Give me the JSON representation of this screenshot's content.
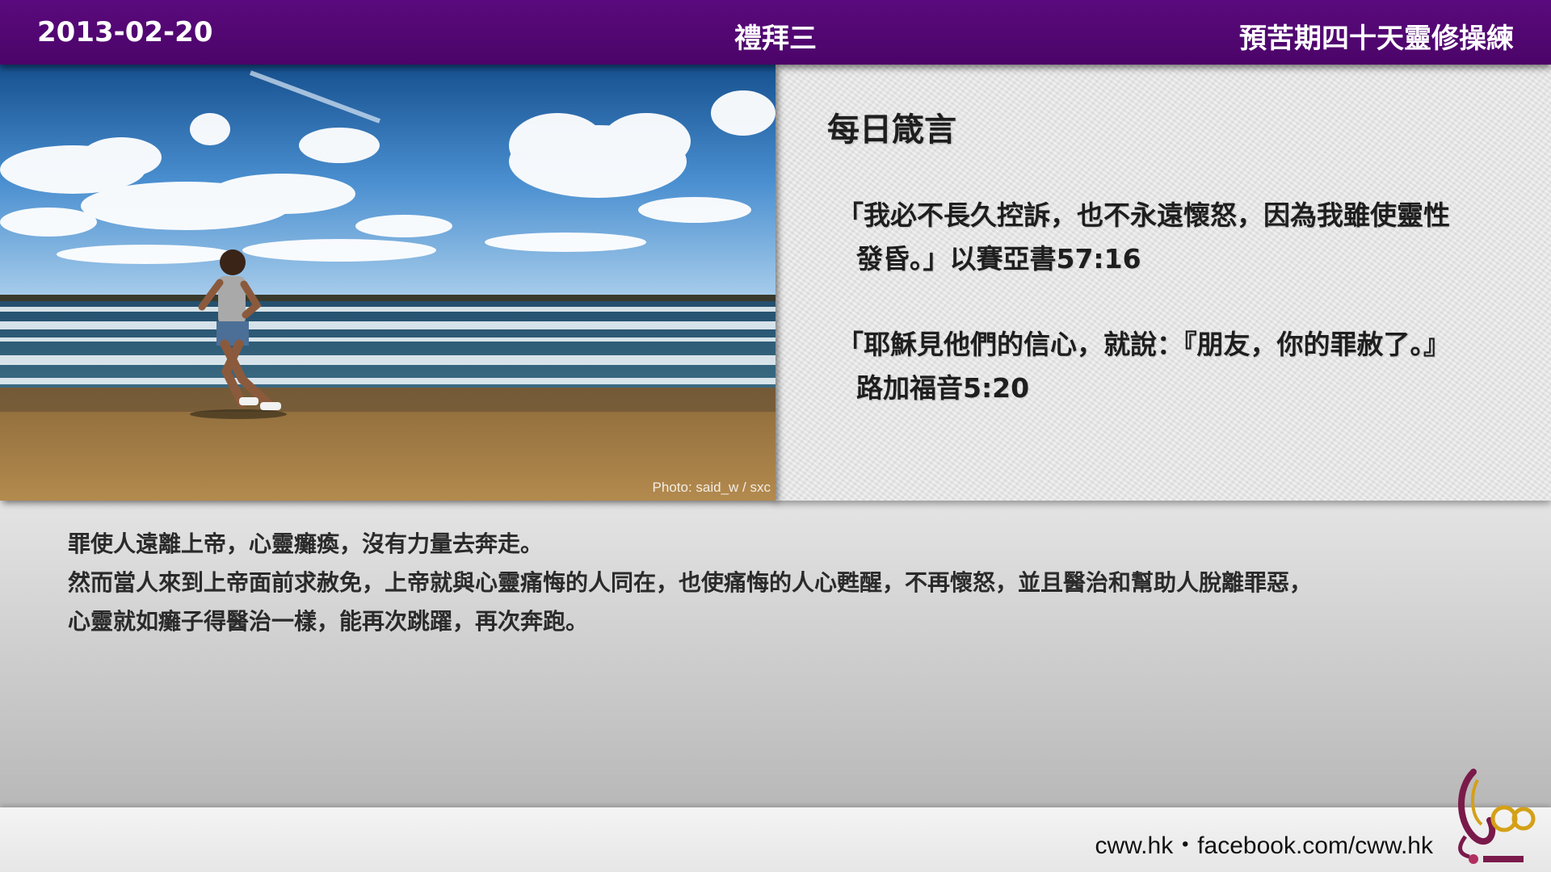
{
  "header": {
    "date": "2013-02-20",
    "weekday": "禮拜三",
    "series": "預苦期四十天靈修操練"
  },
  "photo": {
    "credit": "Photo: said_w / sxc",
    "subject": "runner-on-beach"
  },
  "proverb": {
    "title": "每日箴言",
    "verse1_line1": "「我必不長久控訴，也不永遠懷怒，因為我雖使靈性",
    "verse1_line2": "發昏。」以賽亞書57:16",
    "verse2_line1": "「耶穌見他們的信心，就說：『朋友，你的罪赦了。』",
    "verse2_line2": "路加福音5:20"
  },
  "reflection": {
    "p1": "罪使人遠離上帝，心靈癱瘓，沒有力量去奔走。",
    "p2": "然而當人來到上帝面前求赦免，上帝就與心靈痛悔的人同在，也使痛悔的人心甦醒，不再懷怒，並且醫治和幫助人脫離罪惡，",
    "p3": "心靈就如癱子得醫治一樣，能再次跳躍，再次奔跑。"
  },
  "footer": {
    "links": "cww.hk・facebook.com/cww.hk"
  },
  "colors": {
    "header_bg": "#4b0468",
    "logo_accent": "#7a1a4a",
    "logo_gold": "#d4a017"
  }
}
